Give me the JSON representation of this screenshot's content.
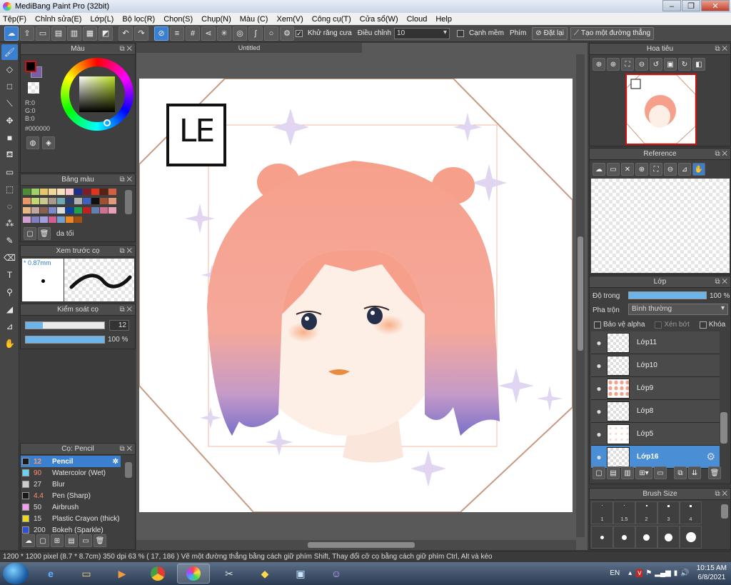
{
  "window": {
    "title": "MediBang Paint Pro (32bit)"
  },
  "menu": [
    "Tệp(F)",
    "Chỉnh sửa(E)",
    "Lớp(L)",
    "Bộ lọc(R)",
    "Chọn(S)",
    "Chụp(N)",
    "Màu (C)",
    "Xem(V)",
    "Công cụ(T)",
    "Cửa sổ(W)",
    "Cloud",
    "Help"
  ],
  "toolbar": {
    "antialias_label": "Khử răng cưa",
    "adjust_label": "Điều chỉnh",
    "adjust_value": "10",
    "soft_edge_label": "Cạnh mềm",
    "key_label": "Phím",
    "reset_label": "Đặt lại",
    "straight_line_label": "Tạo một đường thẳng"
  },
  "color_panel": {
    "title": "Màu",
    "r": "R:0",
    "g": "G:0",
    "b": "B:0",
    "hex": "#000000",
    "fg_color": "#000000",
    "bg_color": "#7a5fa8"
  },
  "palette_panel": {
    "title": "Bảng màu",
    "palette_name": "da tối",
    "colors": [
      "#4c8c34",
      "#9fd06a",
      "#e8c46a",
      "#f0d898",
      "#f8e0c0",
      "#f6c8d0",
      "#1f2e8c",
      "#7e1e2a",
      "#e0341e",
      "#5a2010",
      "#d06040",
      "#e89868",
      "#c4d870",
      "#c8c890",
      "#a89890",
      "#70a8b0",
      "#2c3c6c",
      "#b0b0b0",
      "#4060c0",
      "#101010",
      "#a05030",
      "#e09a78",
      "#e8b880",
      "#c0a8a0",
      "#8a6050",
      "#7a8ac8",
      "#dcdcdc",
      "#1040a0",
      "#20a050",
      "#c02020",
      "#6080b0",
      "#d07090",
      "#e8a0b8",
      "#d0a0d0",
      "#8080c0",
      "#a0a0e0",
      "#d06090",
      "#70a0d0",
      "#f08820",
      "#a05010"
    ]
  },
  "brush_preview_panel": {
    "title": "Xem trước cọ",
    "size": "* 0.87mm"
  },
  "brush_control_panel": {
    "title": "Kiểm soát cọ",
    "size_value": "12",
    "opacity_value": "100 %",
    "size_fraction": 0.22,
    "opacity_fraction": 1.0
  },
  "brush_list_panel": {
    "title": "Cọ: Pencil",
    "items": [
      {
        "size": "12",
        "name": "Pencil",
        "color": "#1a1a1a",
        "selected": true
      },
      {
        "size": "90",
        "name": "Watercolor (Wet)",
        "color": "#6ad2f0",
        "selected": false
      },
      {
        "size": "27",
        "name": "Blur",
        "color": "#cccccc",
        "selected": false
      },
      {
        "size": "4.4",
        "name": "Pen (Sharp)",
        "color": "#1a1a1a",
        "selected": false
      },
      {
        "size": "50",
        "name": "Airbrush",
        "color": "#f0a0e8",
        "selected": false
      },
      {
        "size": "15",
        "name": "Plastic Crayon (thick)",
        "color": "#e8d820",
        "selected": false
      },
      {
        "size": "200",
        "name": "Bokeh (Sparkle)",
        "color": "#3050d0",
        "selected": false
      }
    ]
  },
  "canvas": {
    "tab_title": "Untitled",
    "logo_text": "LE"
  },
  "navigator_panel": {
    "title": "Hoa tiêu"
  },
  "reference_panel": {
    "title": "Reference"
  },
  "layers_panel": {
    "title": "Lớp",
    "opacity_label": "Độ trong",
    "opacity_value": "100 %",
    "opacity_fraction": 1.0,
    "blend_label": "Pha trộn",
    "blend_value": "Bình thường",
    "protect_alpha_label": "Bảo vệ alpha",
    "clip_label": "Xén bớt",
    "lock_label": "Khóa",
    "layers": [
      {
        "name": "Lớp11",
        "selected": false
      },
      {
        "name": "Lớp10",
        "selected": false
      },
      {
        "name": "Lớp9",
        "selected": false
      },
      {
        "name": "Lớp8",
        "selected": false
      },
      {
        "name": "Lớp5",
        "selected": false
      },
      {
        "name": "Lớp16",
        "selected": true
      }
    ]
  },
  "brush_size_panel": {
    "title": "Brush Size",
    "labels_row1": [
      "1",
      "1.5",
      "2",
      "3",
      "4"
    ]
  },
  "status": {
    "text": "1200 * 1200 pixel   (8.7 * 8.7cm)   350 dpi   63 %   ( 17, 186 )   Vẽ một đường thẳng bằng cách giữ phím Shift, Thay đổi cỡ cọ bằng cách giữ phím Ctrl, Alt và kéo"
  },
  "taskbar": {
    "lang": "EN",
    "time": "10:15 AM",
    "date": "6/8/2021"
  }
}
